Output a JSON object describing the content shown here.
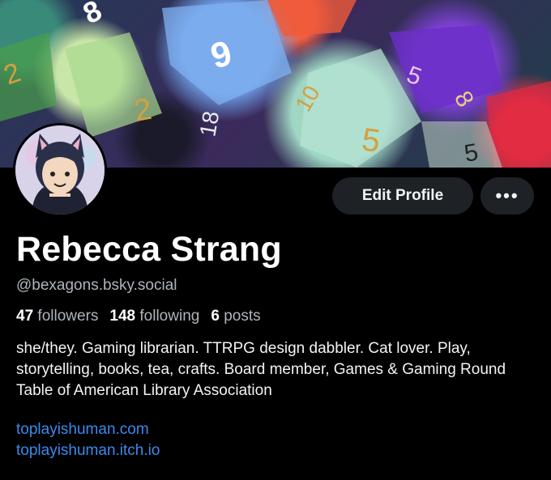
{
  "profile": {
    "name": "Rebecca Strang",
    "handle": "@bexagons.bsky.social",
    "banner_subject": "dice-banner",
    "avatar_subject": "cat-ears-avatar"
  },
  "actions": {
    "edit_label": "Edit Profile",
    "more_label": "•••"
  },
  "stats": {
    "followers_count": "47",
    "followers_label": "followers",
    "following_count": "148",
    "following_label": "following",
    "posts_count": "6",
    "posts_label": "posts"
  },
  "bio": "she/they. Gaming librarian. TTRPG design dabbler. Cat lover. Play, storytelling, books, tea, crafts. Board member, Games & Gaming Round Table of American Library Association",
  "links": [
    "toplayishuman.com",
    "toplayishuman.itch.io"
  ],
  "colors": {
    "background": "#000000",
    "link": "#3b8aee",
    "button_bg": "#1e2126",
    "muted_text": "#aeb4bb"
  }
}
